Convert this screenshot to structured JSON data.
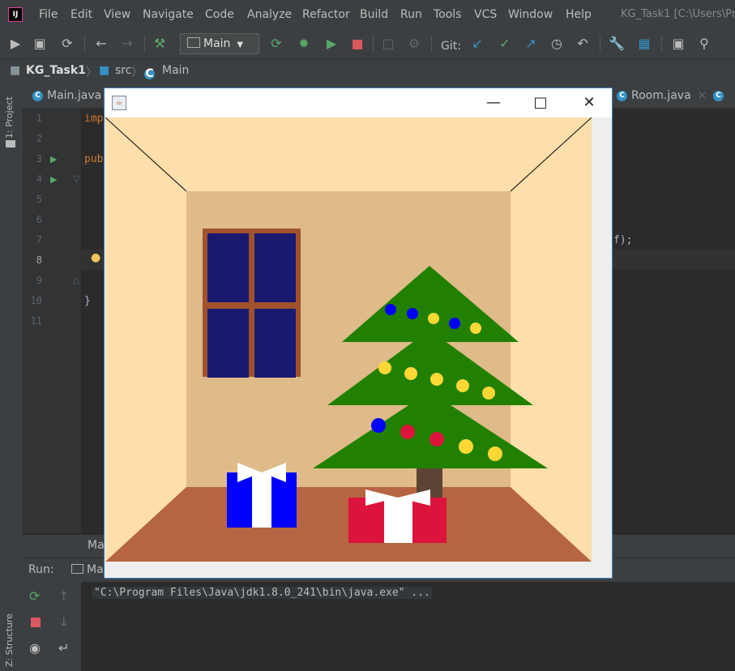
{
  "menubar": {
    "logo": "IJ",
    "items": [
      "File",
      "Edit",
      "View",
      "Navigate",
      "Code",
      "Analyze",
      "Refactor",
      "Build",
      "Run",
      "Tools",
      "VCS",
      "Window",
      "Help"
    ],
    "project_title": "KG_Task1 [C:\\Users\\Pr"
  },
  "toolbar": {
    "run_config": "Main",
    "git_label": "Git:"
  },
  "breadcrumb": {
    "project": "KG_Task1",
    "folder": "src",
    "file": "Main"
  },
  "left_strip": {
    "project_label": "1: Project",
    "structure_label": "Z: Structure"
  },
  "editor_tabs": [
    {
      "label": "Main.java"
    },
    {
      "label": "Room.java"
    }
  ],
  "code": {
    "line_numbers": [
      "1",
      "2",
      "3",
      "4",
      "5",
      "6",
      "7",
      "8",
      "9",
      "10",
      "11"
    ],
    "line1": "imp",
    "line3": "pub",
    "line10": "}",
    "fragment_right": "f);",
    "current_line": "8"
  },
  "run_panel": {
    "label": "Run:",
    "tab_label": "Ma",
    "tab_above": "Ma",
    "console_text": "\"C:\\Program Files\\Java\\jdk1.8.0_241\\bin\\java.exe\" ..."
  },
  "colors": {
    "wall_back": "#debb89",
    "wall_side": "#fedeab",
    "floor": "#b66542",
    "window_frame": "#a0522d",
    "window_glass": "#191970",
    "tree": "#228000",
    "trunk": "#5c4434",
    "gift_blue": "#0000ff",
    "gift_red": "#dc143c",
    "ribbon": "#ffffff",
    "ball_blue": "#0000ff",
    "ball_yellow": "#fdd835",
    "ball_red": "#dc143c"
  }
}
